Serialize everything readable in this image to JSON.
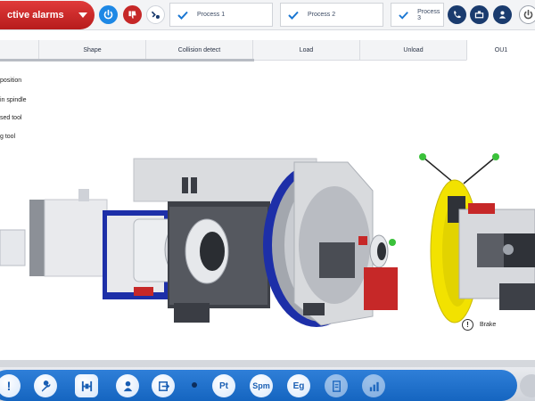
{
  "topbar": {
    "alarm_label": "ctive alarms",
    "processes": [
      "Process 1",
      "Process 2",
      "Process 3"
    ],
    "icons": {
      "power": "power-icon",
      "alarm_flag": "thumbs-down-icon",
      "tools": "tools-icon",
      "phone": "phone-icon",
      "machine": "machine-icon",
      "user": "user-icon",
      "power_off": "power-off-icon"
    }
  },
  "tabs": [
    "Shape",
    "Collision detect",
    "Load",
    "Unload",
    "OU1"
  ],
  "active_tab": "OU1",
  "options": [
    "position",
    "in spindle",
    "sed tool",
    "g tool"
  ],
  "scene": {
    "brake_label": "Brake",
    "brake_indicator": "!"
  },
  "bottombar": {
    "buttons": [
      {
        "icon": "alert-icon",
        "label": "!"
      },
      {
        "icon": "wrench-icon",
        "label": ""
      },
      {
        "icon": "gripper-icon",
        "label": ""
      },
      {
        "icon": "operator-icon",
        "label": ""
      },
      {
        "icon": "exit-icon",
        "label": ""
      },
      {
        "icon": "pt-icon",
        "label": "Pt"
      },
      {
        "icon": "spm-icon",
        "label": "Spm"
      },
      {
        "icon": "eg-icon",
        "label": "Eg"
      },
      {
        "icon": "document-icon",
        "label": ""
      },
      {
        "icon": "chart-icon",
        "label": ""
      }
    ]
  },
  "colors": {
    "accent_blue": "#1565c0",
    "alarm_red": "#c62828",
    "check_blue": "#1976d2",
    "topbar_navy": "#1a3b6e",
    "status_green": "#3ac13a",
    "brake_yellow": "#f2e200"
  }
}
